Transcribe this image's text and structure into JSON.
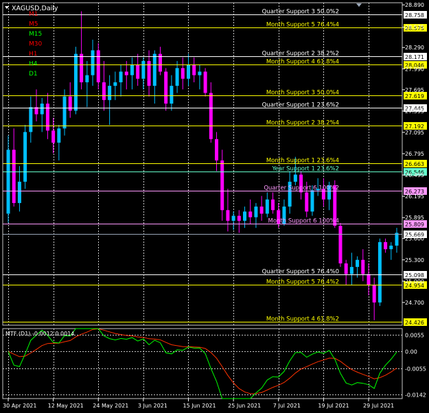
{
  "window": {
    "symbol_title": "XAGUSD,Daily",
    "timeframes": [
      {
        "label": "M1",
        "color": "#ff0000"
      },
      {
        "label": "M5",
        "color": "#ff0000"
      },
      {
        "label": "M15",
        "color": "#00ff00"
      },
      {
        "label": "M30",
        "color": "#ff0000"
      },
      {
        "label": "H1",
        "color": "#ff0000"
      },
      {
        "label": "H4",
        "color": "#00ff00"
      },
      {
        "label": "D1",
        "color": "#00ff00"
      }
    ]
  },
  "colors": {
    "background": "#000000",
    "grid": "#c8c8c8",
    "bull_candle": "#00bfff",
    "bear_candle": "#ff00ff",
    "level_yellow": "#ffff00",
    "level_white": "#ffffff",
    "level_pink": "#ff99ff",
    "level_cyan": "#66ffcc",
    "ma_fast": "#00ff00",
    "ma_slow": "#ff3300",
    "axis_text": "#ffffff"
  },
  "price_axis": {
    "ticks": [
      "28.890",
      "28.575",
      "28.290",
      "27.990",
      "27.695",
      "27.395",
      "27.095",
      "26.795",
      "26.495",
      "26.195",
      "25.895",
      "25.600",
      "25.300",
      "25.000",
      "24.700"
    ],
    "current_price": "25.669"
  },
  "levels": [
    {
      "label": "Quarter Support 3 50.0%2",
      "price": "28.758",
      "color_key": "level_white"
    },
    {
      "label": "Month Support 5 76.4%4",
      "price": "28.575",
      "color_key": "level_yellow"
    },
    {
      "label": "Quarter Support 2 38.2%2",
      "price": "28.171",
      "color_key": "level_white"
    },
    {
      "label": "Month Support 4 61.8%4",
      "price": "28.046",
      "color_key": "level_yellow"
    },
    {
      "label": "Month Support 3 50.0%4",
      "price": "27.619",
      "color_key": "level_yellow"
    },
    {
      "label": "Quarter Support 1 23.6%2",
      "price": "27.445",
      "color_key": "level_white"
    },
    {
      "label": "Month Support 2 38.2%4",
      "price": "27.192",
      "color_key": "level_yellow"
    },
    {
      "label": "Month Support 1 23.6%4",
      "price": "26.663",
      "color_key": "level_yellow"
    },
    {
      "label": "Year Support 1 23.6%2",
      "price": "26.546",
      "color_key": "level_cyan"
    },
    {
      "label": "Quarter Support 6 100%2",
      "price": "26.273",
      "color_key": "level_pink"
    },
    {
      "label": "Month Support 6 100%4",
      "price": "25.809",
      "color_key": "level_pink"
    },
    {
      "label": "Quarter Support 5 76.4%0",
      "price": "25.098",
      "color_key": "level_white"
    },
    {
      "label": "Month Support 5 76.4%2",
      "price": "24.954",
      "color_key": "level_yellow"
    },
    {
      "label": "Month Support 4 61.8%2",
      "price": "24.426",
      "color_key": "level_yellow"
    }
  ],
  "date_axis": {
    "labels": [
      "30 Apr 2021",
      "12 May 2021",
      "24 May 2021",
      "3 Jun 2021",
      "15 Jun 2021",
      "25 Jun 2021",
      "7 Jul 2021",
      "19 Jul 2021",
      "29 Jul 2021"
    ]
  },
  "indicator": {
    "title": "MTF (D1) -0.0012 0.0014",
    "ticks": [
      "0.0055",
      "0.00",
      "-0.0055",
      "-0.0142"
    ]
  },
  "chart_data": {
    "type": "candlestick",
    "symbol": "XAGUSD",
    "timeframe": "Daily",
    "y_range": [
      24.38,
      28.92
    ],
    "candles": [
      [
        25.95,
        27.05,
        25.82,
        26.85
      ],
      [
        26.85,
        27.15,
        26.05,
        26.1
      ],
      [
        26.1,
        26.62,
        25.98,
        26.4
      ],
      [
        26.4,
        27.2,
        26.3,
        27.1
      ],
      [
        27.1,
        27.6,
        26.95,
        27.45
      ],
      [
        27.45,
        27.7,
        27.25,
        27.35
      ],
      [
        27.35,
        27.58,
        27.1,
        27.5
      ],
      [
        27.5,
        27.65,
        27.0,
        27.12
      ],
      [
        27.12,
        27.3,
        26.8,
        26.95
      ],
      [
        26.95,
        27.2,
        26.7,
        27.15
      ],
      [
        27.15,
        27.7,
        27.05,
        27.6
      ],
      [
        27.6,
        27.8,
        27.3,
        27.4
      ],
      [
        27.4,
        28.3,
        27.35,
        28.2
      ],
      [
        28.2,
        28.8,
        27.7,
        27.8
      ],
      [
        27.8,
        28.1,
        27.45,
        27.9
      ],
      [
        27.9,
        28.4,
        27.75,
        28.25
      ],
      [
        28.25,
        28.35,
        27.7,
        27.8
      ],
      [
        27.8,
        28.1,
        27.4,
        27.55
      ],
      [
        27.55,
        27.9,
        27.2,
        27.75
      ],
      [
        27.75,
        27.95,
        27.55,
        27.8
      ],
      [
        27.8,
        28.05,
        27.6,
        27.95
      ],
      [
        27.95,
        28.1,
        27.7,
        27.9
      ],
      [
        27.9,
        28.15,
        27.7,
        28.05
      ],
      [
        28.05,
        28.2,
        27.75,
        27.85
      ],
      [
        27.85,
        28.15,
        27.7,
        28.1
      ],
      [
        28.1,
        28.25,
        27.6,
        27.75
      ],
      [
        27.75,
        28.25,
        27.5,
        28.2
      ],
      [
        28.2,
        28.3,
        27.9,
        27.95
      ],
      [
        27.95,
        28.0,
        27.4,
        27.5
      ],
      [
        27.5,
        27.9,
        27.4,
        27.75
      ],
      [
        27.75,
        28.1,
        27.65,
        28.0
      ],
      [
        28.0,
        28.15,
        27.7,
        27.85
      ],
      [
        27.85,
        28.2,
        27.75,
        28.05
      ],
      [
        28.05,
        28.15,
        27.8,
        27.9
      ],
      [
        27.9,
        28.05,
        27.7,
        27.95
      ],
      [
        27.95,
        28.0,
        27.6,
        27.65
      ],
      [
        27.65,
        27.8,
        26.95,
        27.0
      ],
      [
        27.0,
        27.1,
        26.55,
        26.7
      ],
      [
        26.7,
        26.85,
        25.85,
        26.0
      ],
      [
        26.0,
        26.3,
        25.7,
        25.85
      ],
      [
        25.85,
        25.98,
        25.72,
        25.92
      ],
      [
        25.92,
        26.0,
        25.68,
        25.85
      ],
      [
        25.85,
        26.05,
        25.75,
        25.98
      ],
      [
        25.98,
        26.15,
        25.8,
        25.9
      ],
      [
        25.9,
        26.1,
        25.75,
        26.05
      ],
      [
        26.05,
        26.2,
        25.85,
        25.95
      ],
      [
        25.95,
        26.25,
        25.9,
        26.15
      ],
      [
        26.15,
        26.25,
        25.95,
        26.0
      ],
      [
        26.0,
        26.1,
        25.75,
        25.8
      ],
      [
        25.8,
        26.15,
        25.78,
        26.05
      ],
      [
        26.05,
        26.55,
        25.95,
        26.4
      ],
      [
        26.4,
        26.75,
        26.35,
        26.5
      ],
      [
        26.5,
        26.55,
        26.15,
        26.25
      ],
      [
        26.25,
        26.4,
        25.9,
        25.98
      ],
      [
        25.98,
        26.35,
        25.92,
        26.28
      ],
      [
        26.28,
        26.45,
        26.2,
        26.3
      ],
      [
        26.3,
        26.45,
        26.05,
        26.15
      ],
      [
        26.15,
        26.4,
        26.0,
        26.35
      ],
      [
        26.35,
        26.42,
        25.75,
        25.78
      ],
      [
        25.78,
        25.82,
        25.2,
        25.25
      ],
      [
        25.25,
        25.3,
        24.95,
        25.1
      ],
      [
        25.1,
        25.4,
        24.95,
        25.2
      ],
      [
        25.2,
        25.35,
        25.05,
        25.3
      ],
      [
        25.3,
        25.45,
        25.0,
        25.1
      ],
      [
        25.1,
        25.25,
        24.8,
        24.95
      ],
      [
        24.95,
        25.05,
        24.45,
        24.7
      ],
      [
        24.7,
        25.6,
        24.65,
        25.55
      ],
      [
        25.55,
        25.6,
        25.4,
        25.45
      ],
      [
        25.45,
        25.55,
        25.3,
        25.5
      ],
      [
        25.5,
        25.75,
        25.4,
        25.68
      ]
    ]
  }
}
